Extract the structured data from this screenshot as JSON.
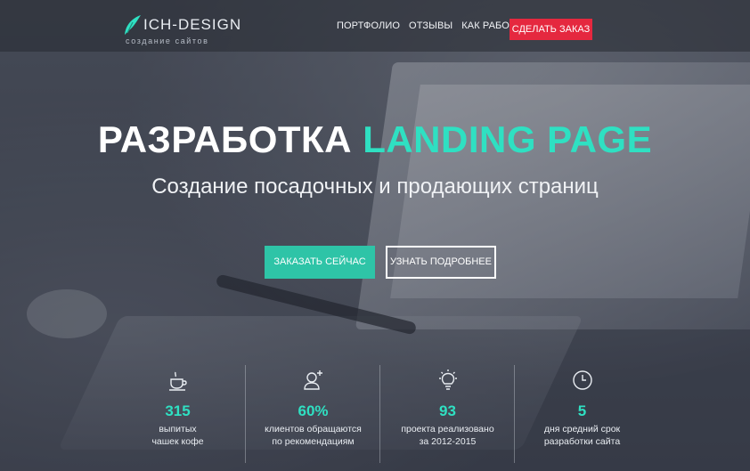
{
  "brand": {
    "title": "ICH-DESIGN",
    "subtitle": "создание сайтов"
  },
  "nav": {
    "items": [
      "ПОРТФОЛИО",
      "ОТЗЫВЫ",
      "КАК РАБОТАЕМ"
    ],
    "cta": "СДЕЛАТЬ ЗАКАЗ"
  },
  "hero": {
    "title_main": "РАЗРАБОТКА",
    "title_accent": "LANDING PAGE",
    "subtitle": "Создание посадочных и продающих страниц",
    "primary_button": "ЗАКАЗАТЬ СЕЙЧАС",
    "secondary_button": "УЗНАТЬ ПОДРОБНЕЕ"
  },
  "stats": [
    {
      "icon": "coffee-cup-icon",
      "value": "315",
      "line1": "выпитых",
      "line2": "чашек кофе"
    },
    {
      "icon": "user-add-icon",
      "value": "60%",
      "line1": "клиентов обращаются",
      "line2": "по рекомендациям"
    },
    {
      "icon": "lightbulb-icon",
      "value": "93",
      "line1": "проекта реализовано",
      "line2": "за 2012-2015"
    },
    {
      "icon": "clock-icon",
      "value": "5",
      "line1": "дня средний срок",
      "line2": "разработки сайта"
    }
  ],
  "colors": {
    "accent": "#2fe0c2",
    "cta_red": "#e5283f",
    "button_teal": "#2ec4a7"
  }
}
